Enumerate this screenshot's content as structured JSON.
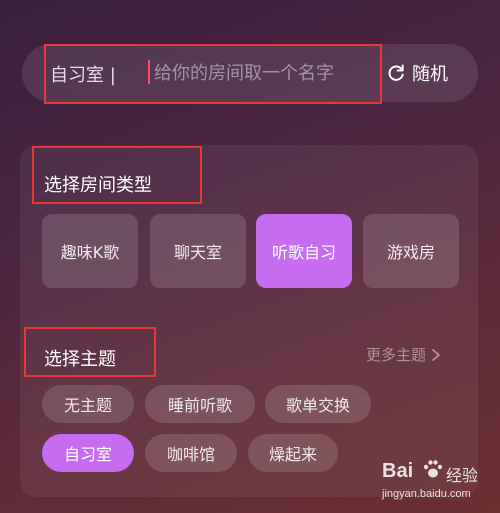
{
  "name_bar": {
    "prefix": "自习室 |",
    "placeholder": "给你的房间取一个名字",
    "random_label": "随机",
    "random_icon": "refresh-icon"
  },
  "room_type": {
    "title": "选择房间类型",
    "options": [
      {
        "label": "趣味K歌",
        "selected": false
      },
      {
        "label": "聊天室",
        "selected": false
      },
      {
        "label": "听歌自习",
        "selected": true
      },
      {
        "label": "游戏房",
        "selected": false
      }
    ]
  },
  "theme": {
    "title": "选择主题",
    "more_label": "更多主题",
    "more_icon": "chevron-right-icon",
    "options": [
      {
        "label": "无主题",
        "selected": false
      },
      {
        "label": "睡前听歌",
        "selected": false
      },
      {
        "label": "歌单交换",
        "selected": false
      },
      {
        "label": "自习室",
        "selected": true
      },
      {
        "label": "咖啡馆",
        "selected": false
      },
      {
        "label": "燥起来",
        "selected": false
      }
    ]
  },
  "watermark": {
    "logo": "Bai",
    "logo_icon": "paw-icon",
    "text": "经验",
    "url": "jingyan.baidu.com"
  },
  "colors": {
    "accent": "#c56cf0",
    "annotation": "#e53935",
    "cursor": "#ff4b6a"
  }
}
